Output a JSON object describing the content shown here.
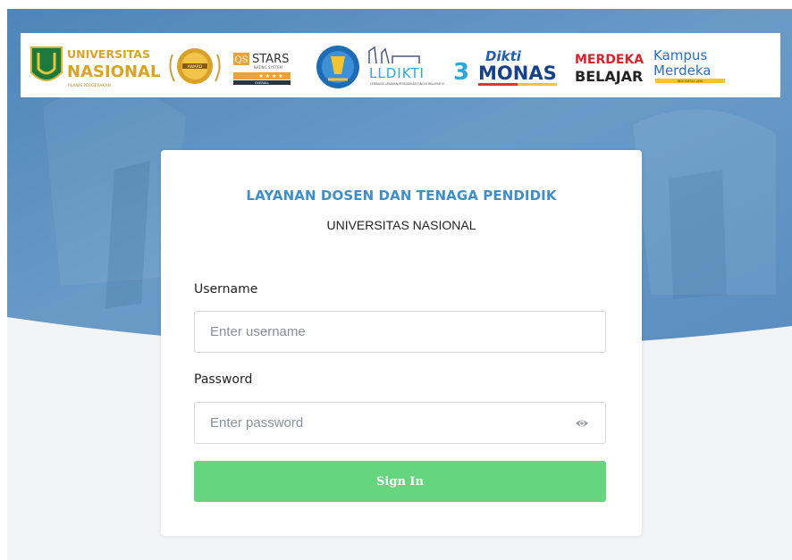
{
  "banner": {
    "logos": [
      {
        "name": "unas-logo",
        "line1": "UNIVERSITAS",
        "line2": "NASIONAL",
        "line3": "PLANIS PERGERAKAN"
      },
      {
        "name": "award-medal",
        "line1": "AWARD"
      },
      {
        "name": "qs-stars-logo",
        "mark": "QS",
        "line1": "STARS",
        "line2": "RATING SYSTEM",
        "line3": "OVERALL"
      },
      {
        "name": "tut-wuri-handayani-logo"
      },
      {
        "name": "lldikti3-logo",
        "line1": "LLDIKTI",
        "num": "3",
        "line2": "LEMBAGA LAYANAN PENDIDIKAN TINGGI WILAYAH III"
      },
      {
        "name": "dikti-monas-logo",
        "line1": "Dikti",
        "line2": "MONAS"
      },
      {
        "name": "merdeka-belajar-logo",
        "line1": "MERDEKA",
        "line2": "BELAJAR"
      },
      {
        "name": "kampus-merdeka-logo",
        "line1": "Kampus",
        "line2": "Merdeka",
        "line3": "INDONESIA JAYA"
      }
    ]
  },
  "card": {
    "title": "LAYANAN DOSEN DAN TENAGA PENDIDIK",
    "subtitle": "UNIVERSITAS NASIONAL",
    "username_label": "Username",
    "username_placeholder": "Enter username",
    "username_value": "",
    "password_label": "Password",
    "password_placeholder": "Enter password",
    "password_value": "",
    "signin_label": "Sign In"
  },
  "colors": {
    "title": "#3d8fca",
    "button": "#66d57f",
    "hero_blue": "#5d8fbe"
  },
  "icons": {
    "password_toggle": "eye-icon"
  }
}
